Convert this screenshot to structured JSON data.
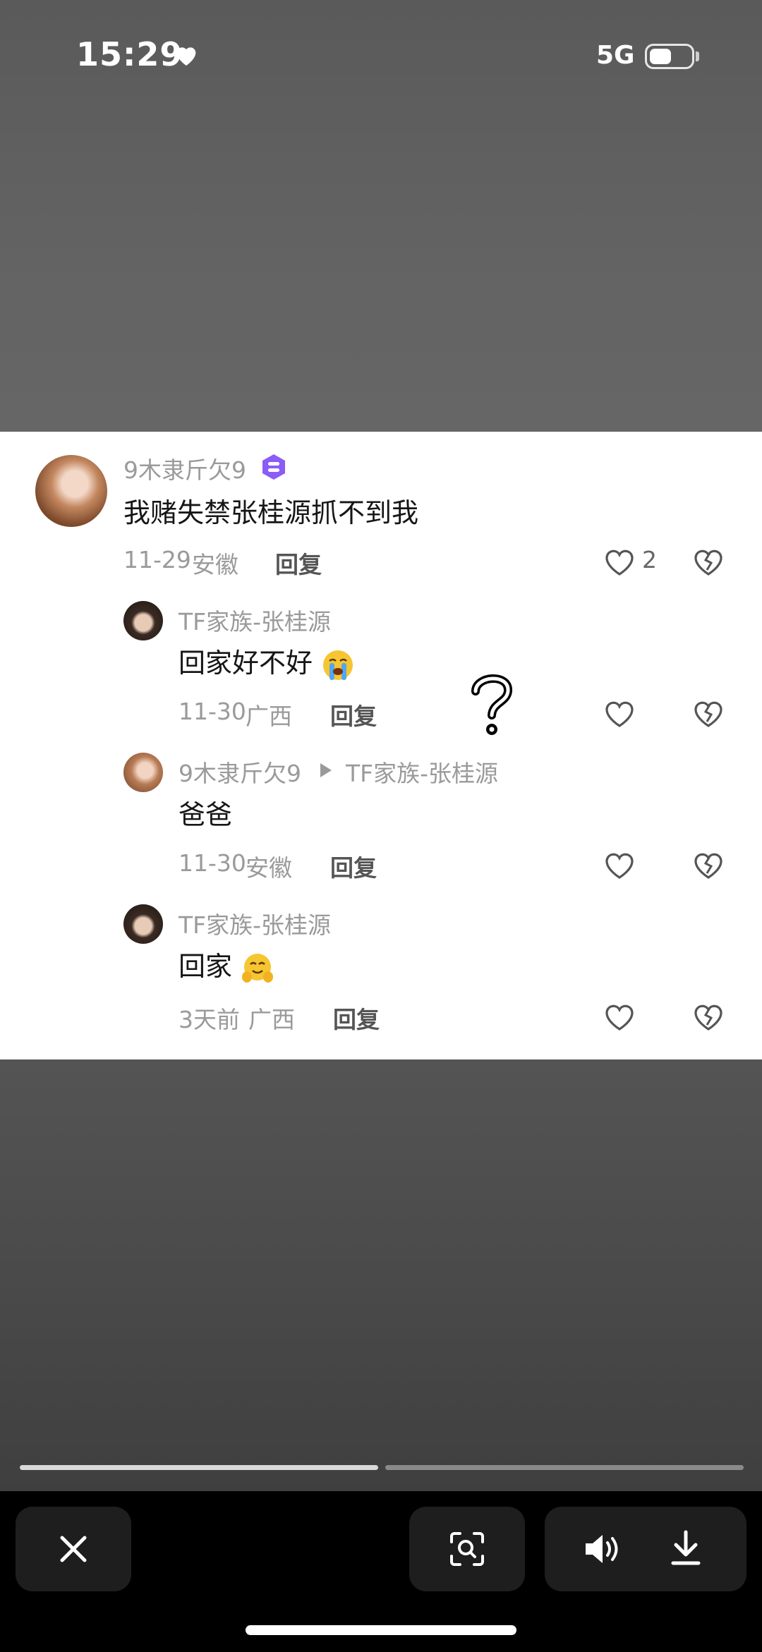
{
  "status_bar": {
    "time": "15:29",
    "network": "5G"
  },
  "comments": [
    {
      "username": "9木隶斤欠9",
      "text": "我赌失禁张桂源抓不到我",
      "date": "11-29",
      "location": "安徽",
      "reply_label": "回复",
      "like_count": "2"
    },
    {
      "username": "TF家族-张桂源",
      "text": "回家好不好",
      "emoji": "crying-face",
      "date": "11-30",
      "location": "广西",
      "reply_label": "回复"
    },
    {
      "username": "9木隶斤欠9",
      "reply_to": "TF家族-张桂源",
      "text": "爸爸",
      "date": "11-30",
      "location": "安徽",
      "reply_label": "回复"
    },
    {
      "username": "TF家族-张桂源",
      "text": "回家",
      "emoji": "hugging-face",
      "date": "3天前",
      "location": "广西",
      "reply_label": "回复"
    }
  ],
  "viewer": {
    "progress_segments": 2,
    "current_segment": 1
  },
  "colors": {
    "badge": "#8b5cf6",
    "card_bg": "#ffffff"
  }
}
